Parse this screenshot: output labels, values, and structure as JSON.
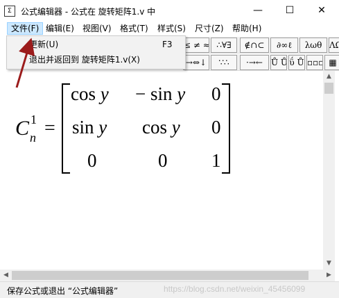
{
  "window": {
    "app_icon": "equation-editor-icon",
    "title": "公式编辑器 - 公式在 旋转矩阵1.v 中",
    "minimize_glyph": "—",
    "maximize_glyph": "☐",
    "close_glyph": "✕"
  },
  "menubar": {
    "items": [
      {
        "label": "文件(F)",
        "active": true
      },
      {
        "label": "编辑(E)"
      },
      {
        "label": "视图(V)"
      },
      {
        "label": "格式(T)"
      },
      {
        "label": "样式(S)"
      },
      {
        "label": "尺寸(Z)"
      },
      {
        "label": "帮助(H)"
      }
    ]
  },
  "file_menu": {
    "items": [
      {
        "label": "更新(U)",
        "shortcut": "F3"
      },
      {
        "label": "退出并返回到 旋转矩阵1.v(X)",
        "shortcut": ""
      }
    ]
  },
  "toolbar": {
    "row1": [
      "≤ ≠ ≈",
      "∴∀∃",
      "∉∩⊂",
      "∂∞ℓ",
      "λωθ",
      "ΛΩ⊗"
    ],
    "row2": [
      "→⇔↓",
      "∵∴",
      "·→←",
      "Ů Ů",
      "ΰ Ů",
      "▫▫▫",
      "▦"
    ]
  },
  "equation": {
    "lhs_base": "C",
    "lhs_superscript": "1",
    "lhs_subscript": "n",
    "equals": "=",
    "matrix": [
      [
        "cos y",
        "− sin y",
        "0"
      ],
      [
        "sin y",
        "cos y",
        "0"
      ],
      [
        "0",
        "0",
        "1"
      ]
    ]
  },
  "scrollbars": {
    "up": "▲",
    "down": "▼",
    "left": "◀",
    "right": "▶"
  },
  "status": {
    "text": "保存公式或退出 “公式编辑器”",
    "watermark": "https://blog.csdn.net/weixin_45456099"
  },
  "colors": {
    "menu_highlight": "#cce8ff",
    "arrow": "#9b1b1b"
  }
}
